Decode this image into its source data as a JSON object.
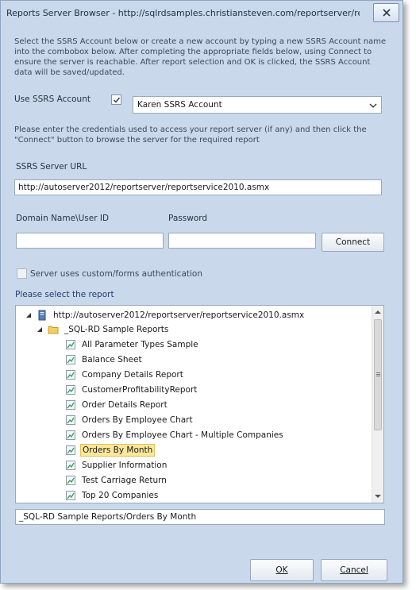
{
  "window": {
    "title": "Reports Server Browser - http://sqlrdsamples.christiansteven.com/reportserver/rep..."
  },
  "intro_text": "Select the SSRS Account below or create a new account by typing a new SSRS Account name into the combobox below. After completing the appropriate fields below, using Connect to ensure the server is reachable. After report selection and OK is clicked, the SSRS Account data will be saved/updated.",
  "use_account": {
    "label": "Use SSRS Account",
    "checked": true,
    "selected_account": "Karen SSRS Account"
  },
  "credentials_text": "Please enter the credentials used to access your report server (if any) and then click the \"Connect\" button to browse the server for the required report",
  "server_url": {
    "label": "SSRS Server URL",
    "value": "http://autoserver2012/reportserver/reportservice2010.asmx"
  },
  "domain_user": {
    "label": "Domain Name\\User ID",
    "value": ""
  },
  "password": {
    "label": "Password",
    "value": ""
  },
  "connect_label": "Connect",
  "custom_auth": {
    "label": "Server uses custom/forms authentication",
    "checked": false
  },
  "select_report_label": "Please select the report",
  "tree": {
    "root": "http://autoserver2012/reportserver/reportservice2010.asmx",
    "folder": "_SQL-RD Sample Reports",
    "reports": [
      "All Parameter Types Sample",
      "Balance Sheet",
      "Company Details Report",
      "CustomerProfitabilityReport",
      "Order Details Report",
      "Orders By Employee Chart",
      "Orders By Employee Chart - Multiple Companies",
      "Orders By Month",
      "Supplier Information",
      "Test Carriage Return",
      "Top 20 Companies"
    ],
    "selected_index": 7
  },
  "selected_path": "_SQL-RD Sample Reports/Orders By Month",
  "buttons": {
    "ok": "OK",
    "cancel": "Cancel"
  },
  "colors": {
    "window_bg": "#c9d8ea",
    "selection": "#fbe89a",
    "label_blue": "#1f3f73"
  }
}
